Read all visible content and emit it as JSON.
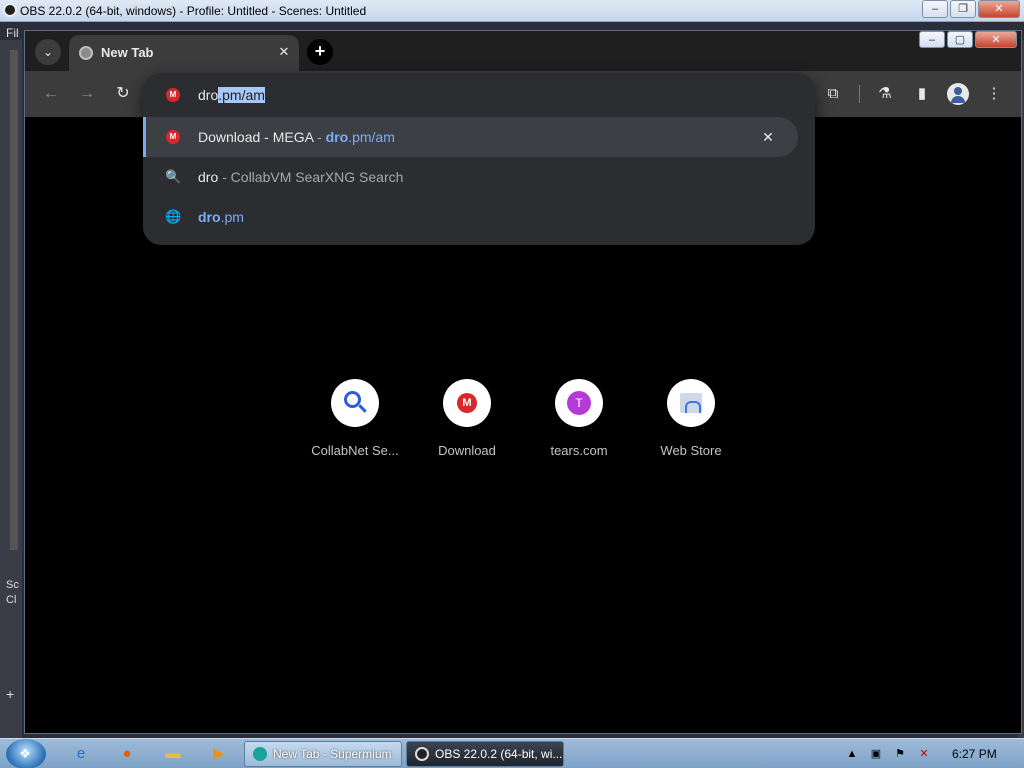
{
  "obs": {
    "title": "OBS 22.0.2 (64-bit, windows) - Profile: Untitled - Scenes: Untitled",
    "menu_partial": "Fil",
    "side_partial_1": "Sc",
    "side_partial_2": "Cl",
    "add_glyph": "+"
  },
  "browser": {
    "tab": {
      "title": "New Tab",
      "close": "✕"
    },
    "new_tab": "+",
    "tab_list": "⌄",
    "nav": {
      "back": "←",
      "forward": "→",
      "reload": "↻"
    },
    "toolbar_icons": {
      "extensions": "⧉",
      "labs": "⚗",
      "sidebar": "▮",
      "menu": "⋮"
    }
  },
  "omnibox": {
    "typed": "dro",
    "autocomplete": ".pm/am",
    "suggestions": [
      {
        "title": "Download - MEGA",
        "sep": " - ",
        "url_bold": "dro",
        "url_rest": ".pm/am",
        "icon": "M",
        "remove": "✕"
      },
      {
        "query": "dro",
        "engine": " - CollabVM SearXNG Search",
        "icon": "🔍"
      },
      {
        "url_bold": "dro",
        "url_rest": ".pm",
        "icon": "🌐"
      }
    ]
  },
  "shortcuts": [
    {
      "label": "CollabNet Se...",
      "icon": "search-icon"
    },
    {
      "label": "Download",
      "icon": "mega-icon",
      "glyph": "M"
    },
    {
      "label": "tears.com",
      "icon": "letter-t-icon",
      "glyph": "T"
    },
    {
      "label": "Web Store",
      "icon": "web-store-icon"
    }
  ],
  "taskbar": {
    "items": [
      {
        "label": "New Tab - Supermium"
      },
      {
        "label": "OBS 22.0.2 (64-bit, wi..."
      }
    ],
    "clock": "6:27 PM"
  }
}
